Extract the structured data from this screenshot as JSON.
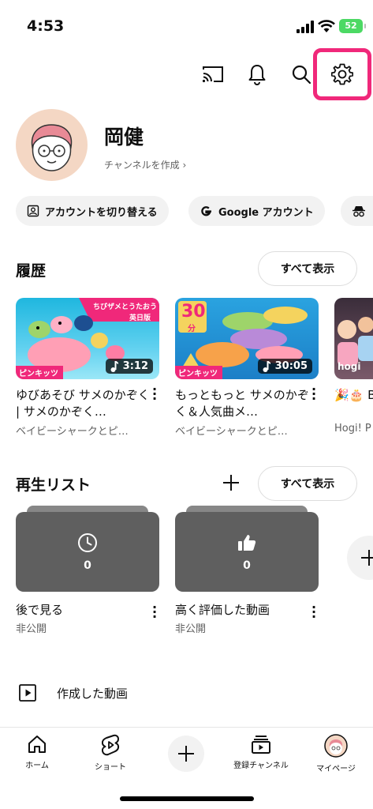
{
  "status_bar": {
    "time": "4:53",
    "battery": "52"
  },
  "profile": {
    "name": "岡健",
    "create_channel": "チャンネルを作成 ›"
  },
  "chips": [
    {
      "label": "アカウントを切り替える",
      "icon": "switch-account-icon"
    },
    {
      "label": "Google アカウント",
      "icon": "google-icon"
    },
    {
      "label": "",
      "icon": "incognito-icon"
    }
  ],
  "history": {
    "title": "履歴",
    "see_all": "すべて表示",
    "videos": [
      {
        "title": "ゆびあそび サメのかぞく | サメのかぞく…",
        "channel": "ベイビーシャークとピ…",
        "duration": "3:12",
        "badge": "ピンキッツ",
        "thumb_text_1": "ちびザメとうたおう",
        "thumb_text_2": "英日版"
      },
      {
        "title": "もっともっと サメのかぞく＆人気曲メ…",
        "channel": "ベイビーシャークとピ…",
        "duration": "30:05",
        "badge": "ピンキッツ",
        "thumb_text_1": "30",
        "thumb_text_2": "分"
      },
      {
        "title": "🎉🎂 Birthd",
        "channel": "Hogi! P",
        "badge": "hogi"
      }
    ]
  },
  "playlists": {
    "title": "再生リスト",
    "see_all": "すべて表示",
    "items": [
      {
        "title": "後で見る",
        "privacy": "非公開",
        "count": "0",
        "icon": "clock-icon"
      },
      {
        "title": "高く評価した動画",
        "privacy": "非公開",
        "count": "0",
        "icon": "thumbs-up-icon"
      }
    ]
  },
  "created_videos": {
    "label": "作成した動画"
  },
  "bottom_nav": [
    {
      "label": "ホーム",
      "icon": "home-icon"
    },
    {
      "label": "ショート",
      "icon": "shorts-icon"
    },
    {
      "label": "",
      "icon": "create-plus-icon"
    },
    {
      "label": "登録チャンネル",
      "icon": "subscriptions-icon"
    },
    {
      "label": "マイページ",
      "icon": "avatar-icon"
    }
  ],
  "colors": {
    "highlight": "#f0287a",
    "playlist_bg": "#5f5f5f",
    "chip_bg": "#f2f2f2"
  }
}
